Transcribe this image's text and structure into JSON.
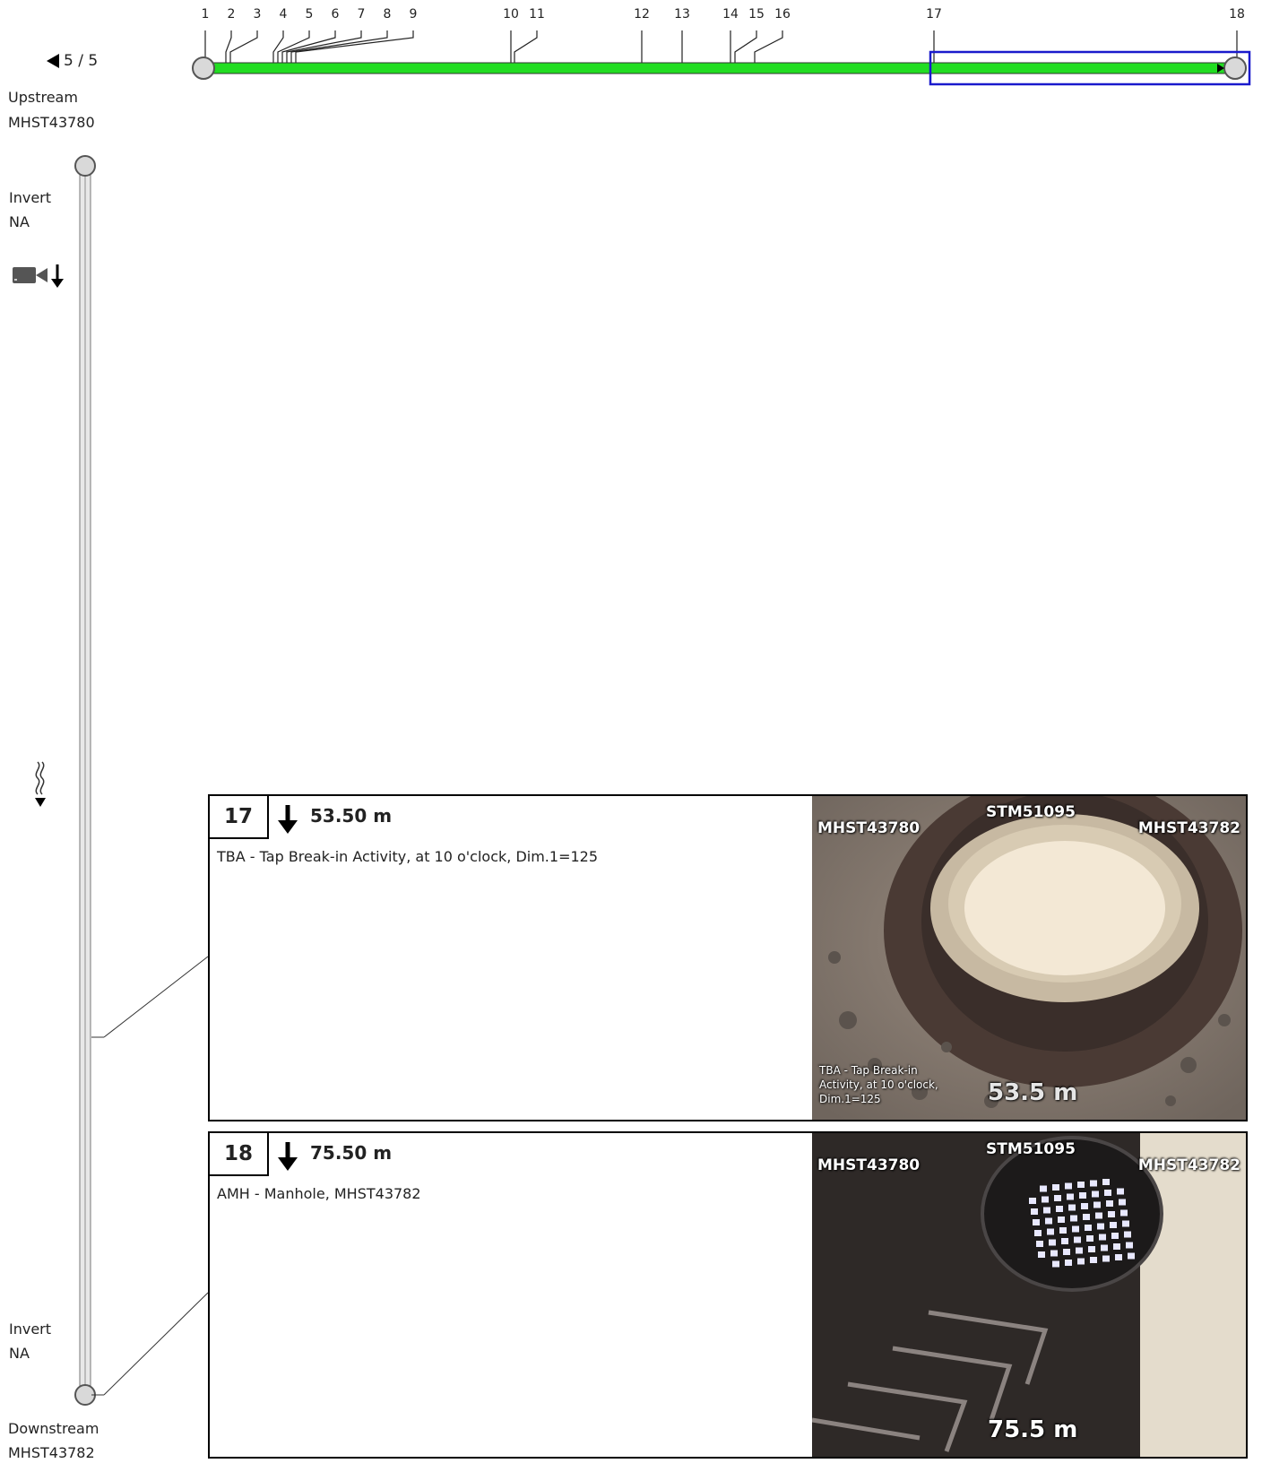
{
  "pager": "5 / 5",
  "upstream": {
    "label": "Upstream",
    "id": "MHST43780"
  },
  "downstream": {
    "label": "Downstream",
    "id": "MHST43782"
  },
  "invert_top": {
    "label": "Invert",
    "value": "NA"
  },
  "invert_bottom": {
    "label": "Invert",
    "value": "NA"
  },
  "ticks": [
    "1",
    "2",
    "3",
    "4",
    "5",
    "6",
    "7",
    "8",
    "9",
    "10",
    "11",
    "12",
    "13",
    "14",
    "15",
    "16",
    "17",
    "18"
  ],
  "pipe_color": "#22dd22",
  "selection_color": "#1a1acc",
  "observations": [
    {
      "number": "17",
      "distance": "53.50 m",
      "description": "TBA - Tap Break-in Activity, at 10 o'clock, Dim.1=125",
      "photo": {
        "left_label": "MHST43780",
        "center_label": "STM51095",
        "right_label": "MHST43782",
        "caption_lines": [
          "TBA - Tap Break-in",
          "Activity, at 10 o'clock,",
          "Dim.1=125"
        ],
        "distance": "53.5 m"
      }
    },
    {
      "number": "18",
      "distance": "75.50 m",
      "description": "AMH - Manhole, MHST43782",
      "photo": {
        "left_label": "MHST43780",
        "center_label": "STM51095",
        "right_label": "MHST43782",
        "distance": "75.5 m"
      }
    }
  ]
}
